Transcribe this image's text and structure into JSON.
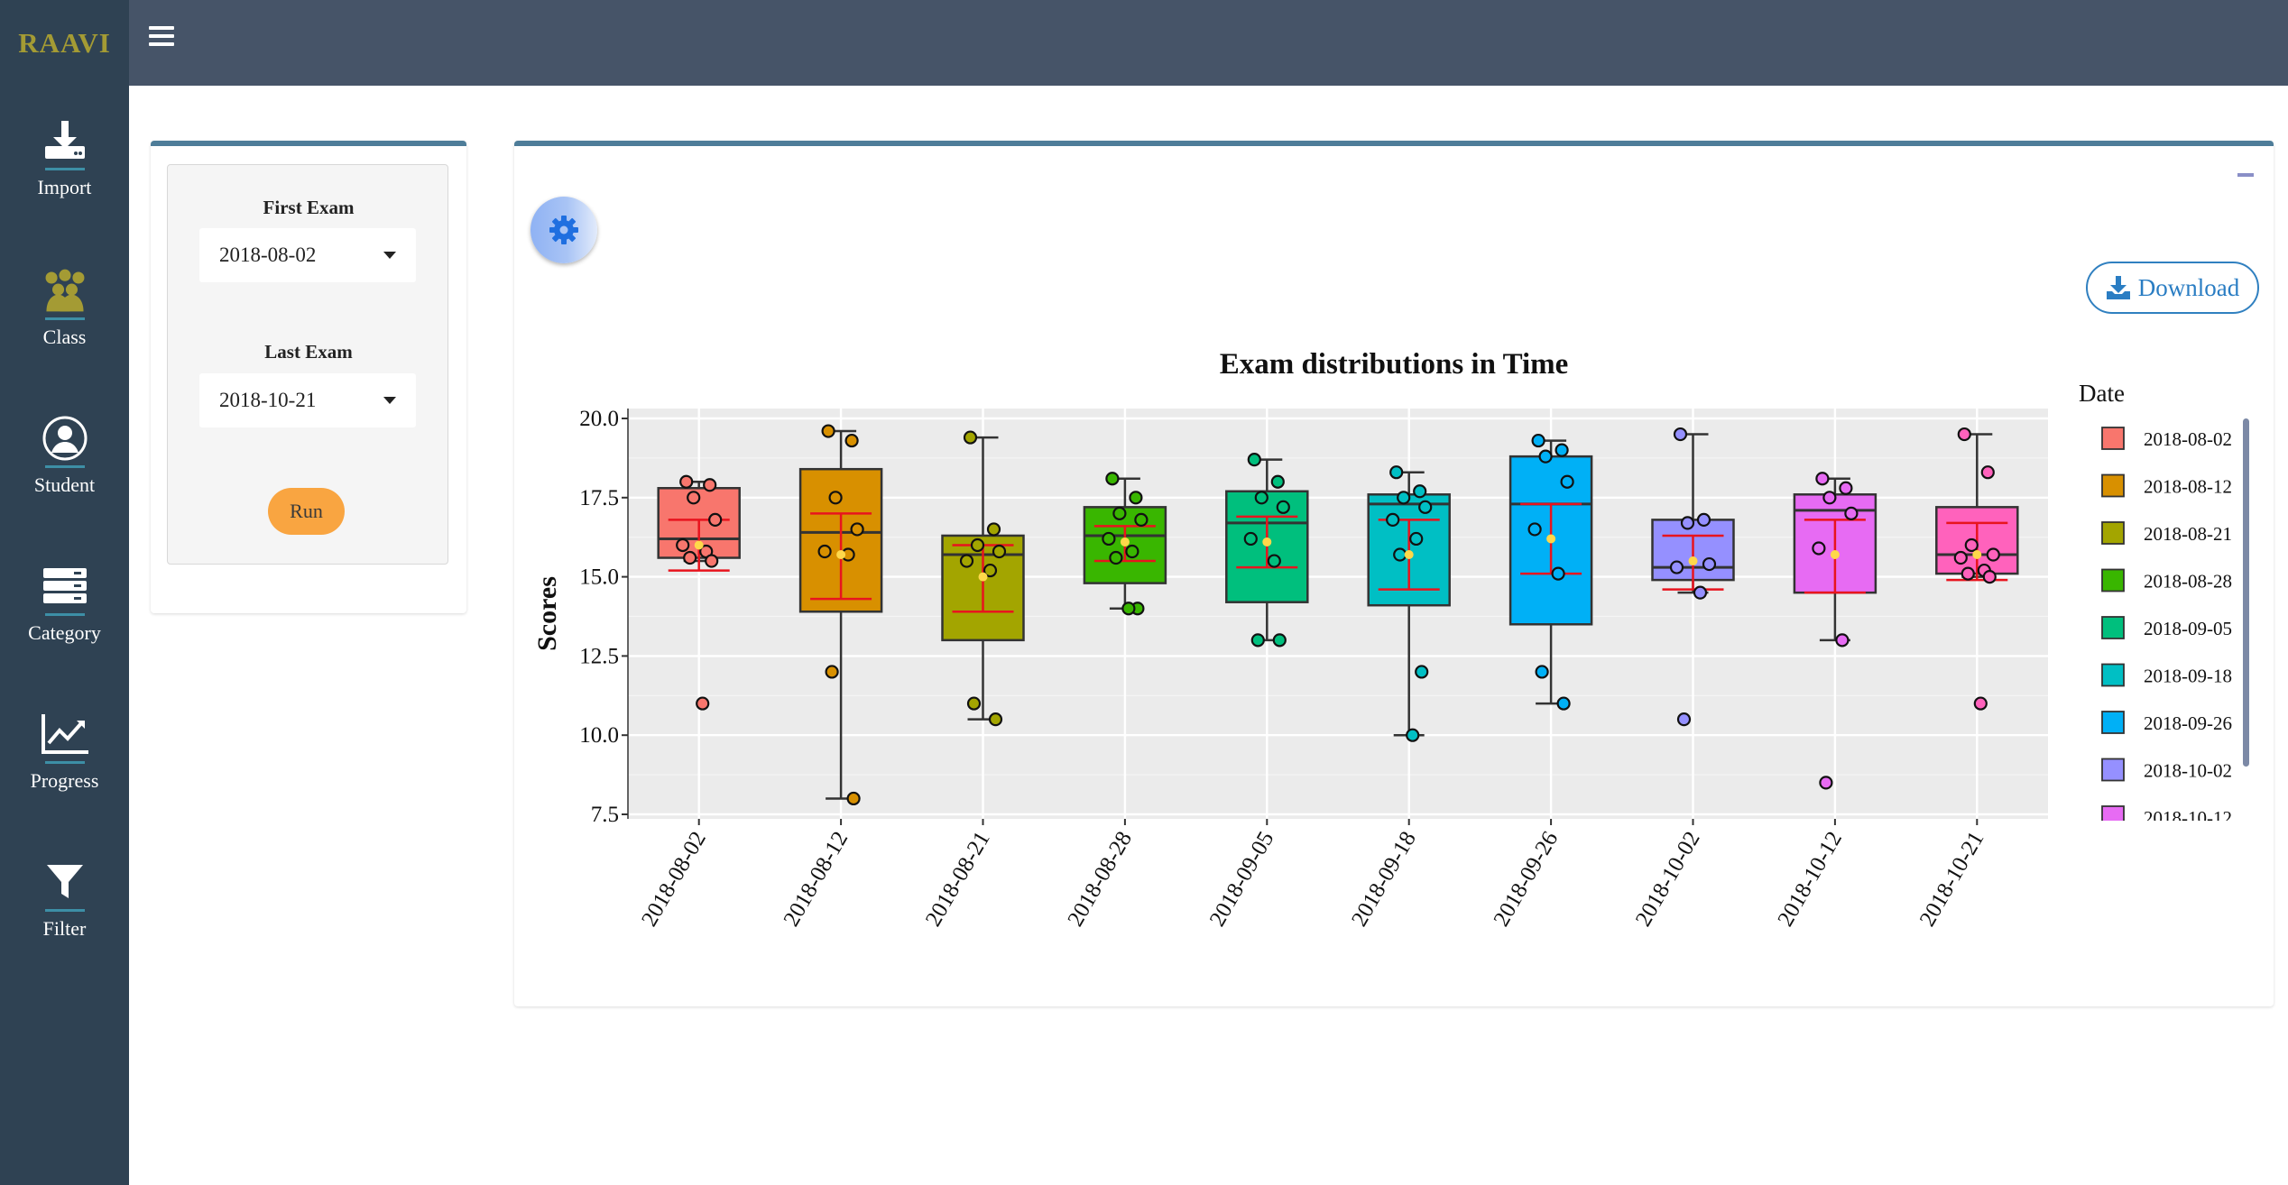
{
  "app": {
    "logo": "RAAVI"
  },
  "sidebar": {
    "items": [
      {
        "label": "Import",
        "icon": "import-icon"
      },
      {
        "label": "Class",
        "icon": "class-icon"
      },
      {
        "label": "Student",
        "icon": "student-icon"
      },
      {
        "label": "Category",
        "icon": "category-icon"
      },
      {
        "label": "Progress",
        "icon": "progress-icon"
      },
      {
        "label": "Filter",
        "icon": "filter-icon"
      }
    ]
  },
  "controls": {
    "first_exam_label": "First Exam",
    "first_exam_value": "2018-08-02",
    "last_exam_label": "Last Exam",
    "last_exam_value": "2018-10-21",
    "run_label": "Run"
  },
  "main": {
    "download_label": "Download"
  },
  "colors": {
    "header": "#465468",
    "sidebar": "#2f4253",
    "logo": "#a49b34",
    "run_button": "#f9a541",
    "accent": "#4e7d99"
  },
  "chart_data": {
    "type": "boxplot",
    "title": "Exam distributions in Time",
    "xlabel": "",
    "ylabel": "Scores",
    "ylim": [
      7.5,
      20.0
    ],
    "yticks": [
      "7.5",
      "10.0",
      "12.5",
      "15.0",
      "17.5",
      "20.0"
    ],
    "grid": true,
    "legend_title": "Date",
    "legend_position": "right",
    "categories": [
      "2018-08-02",
      "2018-08-12",
      "2018-08-21",
      "2018-08-28",
      "2018-09-05",
      "2018-09-18",
      "2018-09-26",
      "2018-10-02",
      "2018-10-12",
      "2018-10-21"
    ],
    "colors": [
      "#f8766d",
      "#d89000",
      "#a3a500",
      "#39b600",
      "#00bf7d",
      "#00bfc4",
      "#00b0f6",
      "#9590ff",
      "#e76bf3",
      "#ff62bc"
    ],
    "boxes": [
      {
        "min": 15.5,
        "q1": 15.6,
        "median": 16.2,
        "q3": 17.8,
        "max": 18.0,
        "mean": 16.0,
        "sd_lo": 15.2,
        "sd_hi": 16.8,
        "points": [
          18.0,
          17.9,
          17.5,
          16.8,
          16.0,
          15.8,
          15.6,
          15.5,
          11.0
        ]
      },
      {
        "min": 8.0,
        "q1": 13.9,
        "median": 16.4,
        "q3": 18.4,
        "max": 19.6,
        "mean": 15.7,
        "sd_lo": 14.3,
        "sd_hi": 17.0,
        "points": [
          19.6,
          19.3,
          17.5,
          16.5,
          15.8,
          15.7,
          12.0,
          8.0
        ]
      },
      {
        "min": 10.5,
        "q1": 13.0,
        "median": 15.7,
        "q3": 16.3,
        "max": 19.4,
        "mean": 15.0,
        "sd_lo": 13.9,
        "sd_hi": 16.0,
        "points": [
          19.4,
          16.5,
          16.0,
          15.8,
          15.5,
          15.2,
          11.0,
          10.5
        ]
      },
      {
        "min": 14.0,
        "q1": 14.8,
        "median": 16.3,
        "q3": 17.2,
        "max": 18.1,
        "mean": 16.1,
        "sd_lo": 15.5,
        "sd_hi": 16.6,
        "points": [
          18.1,
          17.5,
          17.0,
          16.8,
          16.2,
          15.8,
          15.6,
          14.0,
          14.0
        ]
      },
      {
        "min": 13.0,
        "q1": 14.2,
        "median": 16.7,
        "q3": 17.7,
        "max": 18.7,
        "mean": 16.1,
        "sd_lo": 15.3,
        "sd_hi": 16.9,
        "points": [
          18.7,
          18.0,
          17.5,
          17.2,
          16.2,
          15.5,
          13.0,
          13.0
        ]
      },
      {
        "min": 10.0,
        "q1": 14.1,
        "median": 17.3,
        "q3": 17.6,
        "max": 18.3,
        "mean": 15.7,
        "sd_lo": 14.6,
        "sd_hi": 16.8,
        "points": [
          18.3,
          17.7,
          17.5,
          17.2,
          16.8,
          16.2,
          15.7,
          12.0,
          10.0
        ]
      },
      {
        "min": 11.0,
        "q1": 13.5,
        "median": 17.3,
        "q3": 18.8,
        "max": 19.3,
        "mean": 16.2,
        "sd_lo": 15.1,
        "sd_hi": 17.3,
        "points": [
          19.3,
          19.0,
          18.8,
          18.0,
          16.5,
          15.1,
          12.0,
          11.0
        ]
      },
      {
        "min": 14.5,
        "q1": 14.9,
        "median": 15.3,
        "q3": 16.8,
        "max": 19.5,
        "mean": 15.5,
        "sd_lo": 14.6,
        "sd_hi": 16.3,
        "points": [
          19.5,
          16.8,
          16.7,
          15.4,
          15.3,
          14.5,
          10.5
        ]
      },
      {
        "min": 13.0,
        "q1": 14.5,
        "median": 17.1,
        "q3": 17.6,
        "max": 18.1,
        "mean": 15.7,
        "sd_lo": 14.5,
        "sd_hi": 16.8,
        "points": [
          18.1,
          17.8,
          17.5,
          17.0,
          15.9,
          13.0,
          8.5
        ]
      },
      {
        "min": 15.0,
        "q1": 15.1,
        "median": 15.7,
        "q3": 17.2,
        "max": 19.5,
        "mean": 15.7,
        "sd_lo": 14.9,
        "sd_hi": 16.7,
        "points": [
          19.5,
          18.3,
          16.0,
          15.7,
          15.6,
          15.2,
          15.1,
          15.0,
          11.0
        ]
      }
    ]
  }
}
